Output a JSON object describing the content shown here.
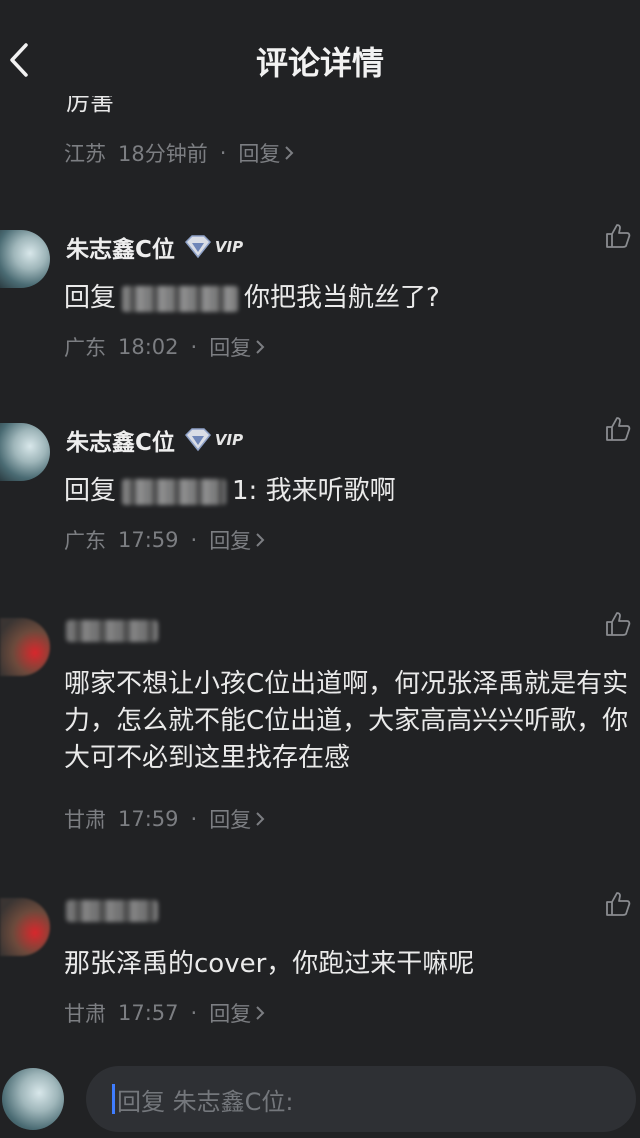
{
  "header": {
    "title": "评论详情"
  },
  "partial_comment": {
    "text_fragment": "厉害",
    "location": "江苏",
    "time": "18分钟前",
    "reply_label": "回复"
  },
  "comments": [
    {
      "username": "朱志鑫C位",
      "vip_label": "VIP",
      "reply_prefix": "回复",
      "text": "你把我当航丝了?",
      "location": "广东",
      "time": "18:02",
      "reply_label": "回复"
    },
    {
      "username": "朱志鑫C位",
      "vip_label": "VIP",
      "reply_prefix": "回复",
      "text": "1: 我来听歌啊",
      "location": "广东",
      "time": "17:59",
      "reply_label": "回复"
    },
    {
      "text": "哪家不想让小孩C位出道啊，何况张泽禹就是有实力，怎么就不能C位出道，大家高高兴兴听歌，你大可不必到这里找存在感",
      "location": "甘肃",
      "time": "17:59",
      "reply_label": "回复"
    },
    {
      "text": "那张泽禹的cover，你跑过来干嘛呢",
      "location": "甘肃",
      "time": "17:57",
      "reply_label": "回复"
    }
  ],
  "reply_input": {
    "placeholder": "回复 朱志鑫C位:"
  },
  "colors": {
    "background": "#212224",
    "meta_text": "#7c7e82",
    "caret": "#3f7dff"
  },
  "icons": [
    "back-icon",
    "vip-diamond-icon",
    "thumbs-up-icon",
    "chevron-right-icon"
  ]
}
